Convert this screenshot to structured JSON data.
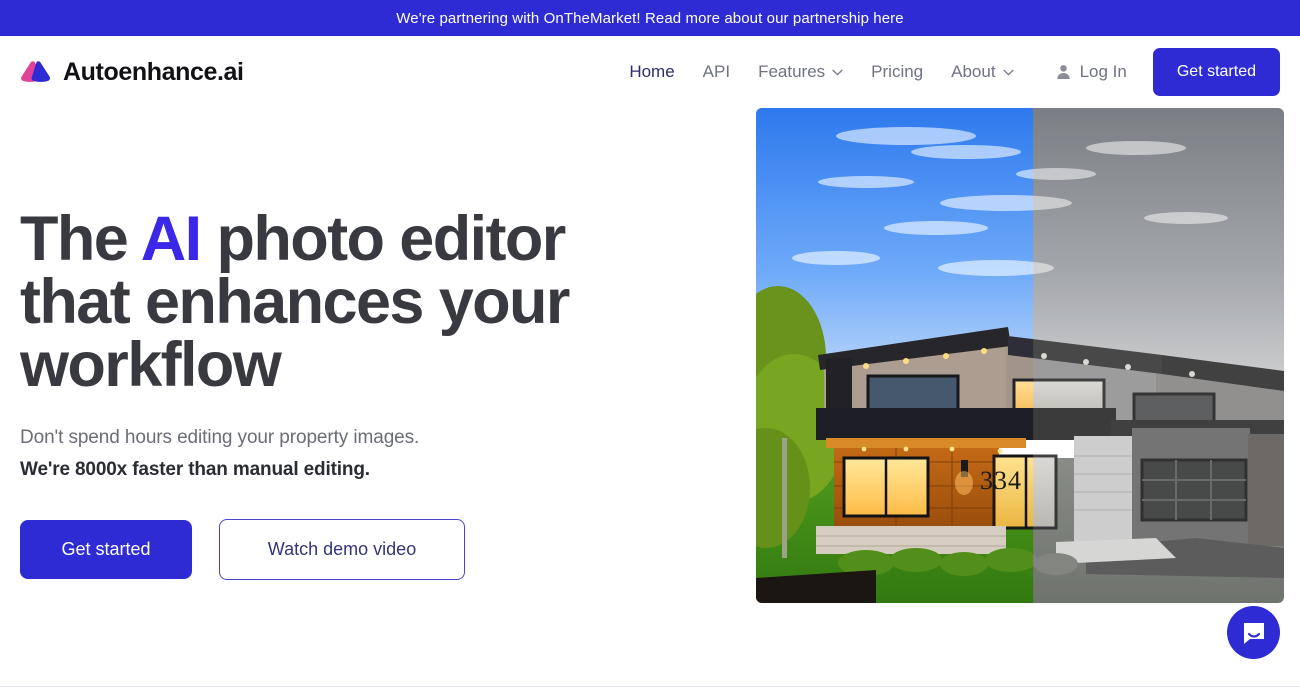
{
  "banner": {
    "text": "We're partnering with OnTheMarket! Read more about our partnership here",
    "bg_color": "#2E2BD4",
    "text_color": "#FFFFFF"
  },
  "header": {
    "brand_name": "Autoenhance.ai",
    "logo_icon": "mountain-logo-icon",
    "logo_colors": {
      "left": "#E0419B",
      "right": "#2E2BD4"
    },
    "nav": [
      {
        "label": "Home",
        "active": true,
        "has_chevron": false,
        "icon": ""
      },
      {
        "label": "API",
        "active": false,
        "has_chevron": false,
        "icon": ""
      },
      {
        "label": "Features",
        "active": false,
        "has_chevron": true,
        "icon": "chevron-down-icon"
      },
      {
        "label": "Pricing",
        "active": false,
        "has_chevron": false,
        "icon": ""
      },
      {
        "label": "About",
        "active": false,
        "has_chevron": true,
        "icon": "chevron-down-icon"
      }
    ],
    "login_label": "Log In",
    "login_icon": "user-icon",
    "get_started_label": "Get started"
  },
  "hero": {
    "headline_part1": "The ",
    "headline_accent": "AI",
    "headline_part2": " photo editor that enhances your workflow",
    "accent_color": "#3A27E8",
    "subtitle_line1": "Don't spend hours editing your property images.",
    "subtitle_line2": "We're 8000x faster than manual editing.",
    "cta_primary_label": "Get started",
    "cta_secondary_label": "Watch demo video",
    "image": {
      "alt": "before-after-house-photo",
      "house_number": "334",
      "split_percent": 52
    }
  },
  "chat_widget": {
    "icon": "chat-bubble-icon",
    "color": "#2E2BD4"
  }
}
